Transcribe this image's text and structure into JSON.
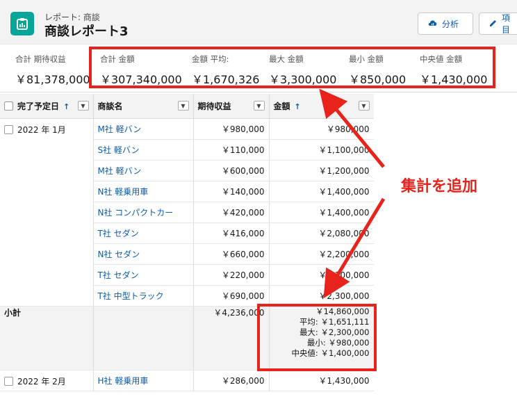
{
  "header": {
    "breadcrumb": "レポート: 商談",
    "title": "商談レポート3",
    "buttons": {
      "analysis": "分析",
      "edit": "項目"
    }
  },
  "summary": {
    "plain": {
      "label": "合計 期待収益",
      "value": "￥81,378,000"
    },
    "highlighted": [
      {
        "label": "合計 金額",
        "value": "￥307,340,000"
      },
      {
        "label": "金額 平均:",
        "value": "￥1,670,326"
      },
      {
        "label": "最大 金額",
        "value": "￥3,300,000"
      },
      {
        "label": "最小 金額",
        "value": "￥850,000"
      },
      {
        "label": "中央値 金額",
        "value": "￥1,430,000"
      }
    ]
  },
  "table": {
    "headers": [
      "完了予定日",
      "商談名",
      "期待収益",
      "金額"
    ],
    "group1": {
      "label": "2022 年 1月",
      "rows": [
        {
          "name": "M社 軽バン",
          "revenue": "￥980,000",
          "amount": "￥980,000"
        },
        {
          "name": "S社 軽バン",
          "revenue": "￥110,000",
          "amount": "￥1,100,000"
        },
        {
          "name": "M社 軽バン",
          "revenue": "￥600,000",
          "amount": "￥1,200,000"
        },
        {
          "name": "N社 軽乗用車",
          "revenue": "￥140,000",
          "amount": "￥1,400,000"
        },
        {
          "name": "N社 コンパクトカー",
          "revenue": "￥420,000",
          "amount": "￥1,400,000"
        },
        {
          "name": "T社 セダン",
          "revenue": "￥416,000",
          "amount": "￥2,080,000"
        },
        {
          "name": "N社 セダン",
          "revenue": "￥660,000",
          "amount": "￥2,200,000"
        },
        {
          "name": "T社 セダン",
          "revenue": "￥220,000",
          "amount": "￥2,200,000"
        },
        {
          "name": "T社 中型トラック",
          "revenue": "￥690,000",
          "amount": "￥2,300,000"
        }
      ]
    },
    "subtotal": {
      "label": "小計",
      "revenue": "￥4,236,000",
      "amount": "￥14,860,000",
      "avg": "平均: ￥1,651,111",
      "max": "最大: ￥2,300,000",
      "min": "最小: ￥980,000",
      "median": "中央値: ￥1,400,000"
    },
    "group2": {
      "label": "2022 年 2月",
      "rows": [
        {
          "name": "H社 軽乗用車",
          "revenue": "￥286,000",
          "amount": "￥1,430,000"
        }
      ]
    }
  },
  "annotation": {
    "text": "集計を追加",
    "color": "#e8231c"
  },
  "colors": {
    "brand": "#06a59a",
    "link": "#0b5cab"
  }
}
